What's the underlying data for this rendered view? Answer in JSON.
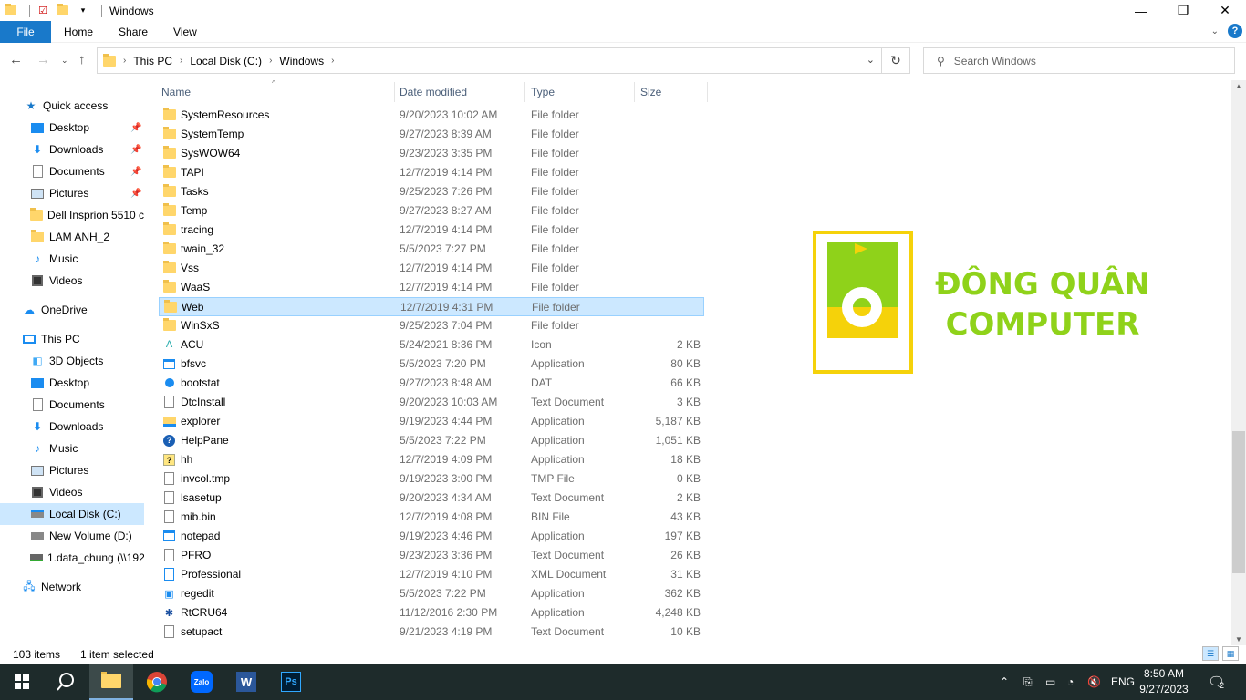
{
  "window": {
    "title": "Windows",
    "controls": {
      "minimize": "—",
      "maximize": "❐",
      "close": "✕"
    }
  },
  "ribbon": {
    "file": "File",
    "tabs": [
      "Home",
      "Share",
      "View"
    ],
    "help": "?"
  },
  "address": {
    "crumbs": [
      "This PC",
      "Local Disk (C:)",
      "Windows"
    ]
  },
  "search": {
    "placeholder": "Search Windows"
  },
  "nav": {
    "quick_access": "Quick access",
    "quick_items": [
      "Desktop",
      "Downloads",
      "Documents",
      "Pictures",
      "Dell Insprion 5510 c",
      "LAM ANH_2",
      "Music",
      "Videos"
    ],
    "onedrive": "OneDrive",
    "this_pc": "This PC",
    "pc_items": [
      "3D Objects",
      "Desktop",
      "Documents",
      "Downloads",
      "Music",
      "Pictures",
      "Videos",
      "Local Disk (C:)",
      "New Volume (D:)",
      "1.data_chung (\\\\192"
    ],
    "network": "Network"
  },
  "columns": {
    "name": "Name",
    "date": "Date modified",
    "type": "Type",
    "size": "Size"
  },
  "files": [
    {
      "name": "SystemResources",
      "date": "9/20/2023 10:02 AM",
      "type": "File folder",
      "size": "",
      "icon": "folder-icon"
    },
    {
      "name": "SystemTemp",
      "date": "9/27/2023 8:39 AM",
      "type": "File folder",
      "size": "",
      "icon": "folder-icon"
    },
    {
      "name": "SysWOW64",
      "date": "9/23/2023 3:35 PM",
      "type": "File folder",
      "size": "",
      "icon": "folder-icon"
    },
    {
      "name": "TAPI",
      "date": "12/7/2019 4:14 PM",
      "type": "File folder",
      "size": "",
      "icon": "folder-icon"
    },
    {
      "name": "Tasks",
      "date": "9/25/2023 7:26 PM",
      "type": "File folder",
      "size": "",
      "icon": "folder-icon"
    },
    {
      "name": "Temp",
      "date": "9/27/2023 8:27 AM",
      "type": "File folder",
      "size": "",
      "icon": "folder-icon"
    },
    {
      "name": "tracing",
      "date": "12/7/2019 4:14 PM",
      "type": "File folder",
      "size": "",
      "icon": "folder-icon"
    },
    {
      "name": "twain_32",
      "date": "5/5/2023 7:27 PM",
      "type": "File folder",
      "size": "",
      "icon": "folder-icon"
    },
    {
      "name": "Vss",
      "date": "12/7/2019 4:14 PM",
      "type": "File folder",
      "size": "",
      "icon": "folder-icon"
    },
    {
      "name": "WaaS",
      "date": "12/7/2019 4:14 PM",
      "type": "File folder",
      "size": "",
      "icon": "folder-icon"
    },
    {
      "name": "Web",
      "date": "12/7/2019 4:31 PM",
      "type": "File folder",
      "size": "",
      "icon": "folder-icon",
      "selected": true
    },
    {
      "name": "WinSxS",
      "date": "9/25/2023 7:04 PM",
      "type": "File folder",
      "size": "",
      "icon": "folder-icon"
    },
    {
      "name": "ACU",
      "date": "5/24/2021 8:36 PM",
      "type": "Icon",
      "size": "2 KB",
      "icon": "acu-icon"
    },
    {
      "name": "bfsvc",
      "date": "5/5/2023 7:20 PM",
      "type": "Application",
      "size": "80 KB",
      "icon": "app-icon"
    },
    {
      "name": "bootstat",
      "date": "9/27/2023 8:48 AM",
      "type": "DAT",
      "size": "66 KB",
      "icon": "dat-icon"
    },
    {
      "name": "DtcInstall",
      "date": "9/20/2023 10:03 AM",
      "type": "Text Document",
      "size": "3 KB",
      "icon": "text-doc-icon"
    },
    {
      "name": "explorer",
      "date": "9/19/2023 4:44 PM",
      "type": "Application",
      "size": "5,187 KB",
      "icon": "explorer-icon"
    },
    {
      "name": "HelpPane",
      "date": "5/5/2023 7:22 PM",
      "type": "Application",
      "size": "1,051 KB",
      "icon": "help-icon"
    },
    {
      "name": "hh",
      "date": "12/7/2019 4:09 PM",
      "type": "Application",
      "size": "18 KB",
      "icon": "hh-icon"
    },
    {
      "name": "invcol.tmp",
      "date": "9/19/2023 3:00 PM",
      "type": "TMP File",
      "size": "0 KB",
      "icon": "blank-file-icon"
    },
    {
      "name": "lsasetup",
      "date": "9/20/2023 4:34 AM",
      "type": "Text Document",
      "size": "2 KB",
      "icon": "text-doc-icon"
    },
    {
      "name": "mib.bin",
      "date": "12/7/2019 4:08 PM",
      "type": "BIN File",
      "size": "43 KB",
      "icon": "blank-file-icon"
    },
    {
      "name": "notepad",
      "date": "9/19/2023 4:46 PM",
      "type": "Application",
      "size": "197 KB",
      "icon": "notepad-icon"
    },
    {
      "name": "PFRO",
      "date": "9/23/2023 3:36 PM",
      "type": "Text Document",
      "size": "26 KB",
      "icon": "text-doc-icon"
    },
    {
      "name": "Professional",
      "date": "12/7/2019 4:10 PM",
      "type": "XML Document",
      "size": "31 KB",
      "icon": "xml-icon"
    },
    {
      "name": "regedit",
      "date": "5/5/2023 7:22 PM",
      "type": "Application",
      "size": "362 KB",
      "icon": "regedit-icon"
    },
    {
      "name": "RtCRU64",
      "date": "11/12/2016 2:30 PM",
      "type": "Application",
      "size": "4,248 KB",
      "icon": "rtcru-icon"
    },
    {
      "name": "setupact",
      "date": "9/21/2023 4:19 PM",
      "type": "Text Document",
      "size": "10 KB",
      "icon": "text-doc-icon"
    }
  ],
  "status": {
    "count": "103 items",
    "selected": "1 item selected"
  },
  "logo": {
    "line1": "ĐÔNG QUÂN",
    "line2": "COMPUTER",
    "colors": {
      "green": "#8fd21a",
      "yellow": "#f5d20a"
    }
  },
  "taskbar": {
    "apps": [
      "start-icon",
      "search-icon",
      "file-explorer-icon",
      "chrome-icon",
      "zalo-icon",
      "word-icon",
      "photoshop-icon"
    ],
    "zalo_label": "Zalo",
    "word_label": "W",
    "ps_label": "Ps",
    "lang": "ENG",
    "time": "8:50 AM",
    "date": "9/27/2023",
    "notifications": "2"
  },
  "colors": {
    "accent": "#1979ca",
    "selection": "#cce8ff",
    "taskbar": "#1e2b2b"
  }
}
